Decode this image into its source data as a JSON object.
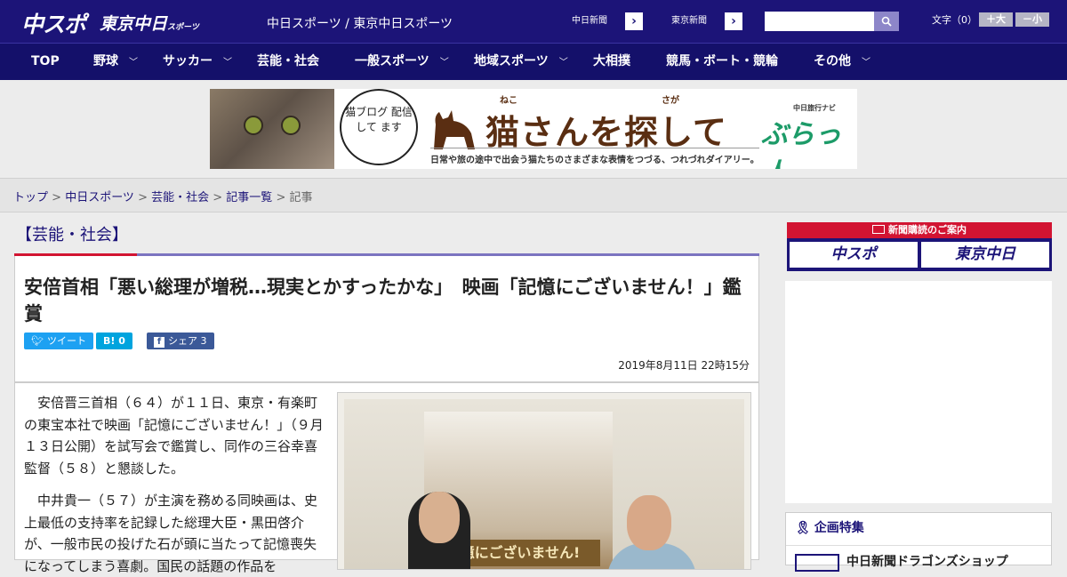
{
  "header": {
    "logo_main": "中スポ",
    "logo_tokyo": "東京中日",
    "logo_tokyo_small": "スポーツ",
    "site_name": "中日スポーツ / 東京中日スポーツ",
    "ext_links": [
      "中日新聞",
      "東京新聞"
    ],
    "search_placeholder": "",
    "font_label": "文字（0）",
    "font_larger": "＋大",
    "font_smaller": "－小"
  },
  "nav": {
    "items": [
      {
        "label": "TOP",
        "has_menu": false
      },
      {
        "label": "野球",
        "has_menu": true
      },
      {
        "label": "サッカー",
        "has_menu": true
      },
      {
        "label": "芸能・社会",
        "has_menu": false
      },
      {
        "label": "一般スポーツ",
        "has_menu": true
      },
      {
        "label": "地域スポーツ",
        "has_menu": true
      },
      {
        "label": "大相撲",
        "has_menu": false
      },
      {
        "label": "競馬・ボート・競輪",
        "has_menu": false
      },
      {
        "label": "その他",
        "has_menu": true
      }
    ]
  },
  "banner": {
    "bubble_text": "猫ブログ 配信して ます",
    "title": "猫さんを探して",
    "ruby_neko": "ねこ",
    "ruby_saga": "さが",
    "subtitle": "日常や旅の途中で出会う猫たちのさまざまな表情をつづる、つれづれダイアリー。",
    "navi_label": "中日旅行ナビ",
    "navi_brand": "ぶらっ人"
  },
  "breadcrumb": {
    "items": [
      "トップ",
      "中日スポーツ",
      "芸能・社会",
      "記事一覧"
    ],
    "current": "記事",
    "separator": " > "
  },
  "category": "【芸能・社会】",
  "article": {
    "headline": "安倍首相「悪い総理が増税…現実とかすったかな」　映画「記憶にございません！」鑑賞",
    "share": {
      "tweet": "ツイート",
      "hatena": "B! 0",
      "facebook": "シェア 3"
    },
    "date": "2019年8月11日 22時15分",
    "paragraphs": [
      "安倍晋三首相（６４）が１１日、東京・有楽町の東宝本社で映画「記憶にございません！」（９月１３日公開）を試写会で鑑賞し、同作の三谷幸喜監督（５８）と懇談した。",
      "中井貴一（５７）が主演を務める同映画は、史上最低の支持率を記録した総理大臣・黒田啓介が、一般市民の投げた石が頭に当たって記憶喪失になってしまう喜劇。国民の話題の作品を"
    ],
    "photo_poster_title": "憶にございません!"
  },
  "sidebar": {
    "subscribe_label": "新聞購読のご案内",
    "logos": [
      "中スポ",
      "東京中日"
    ],
    "feature_title": "企画特集",
    "feature_item": "中日新聞ドラゴンズショップ"
  },
  "colors": {
    "brand_navy": "#1c1478",
    "accent_red": "#d21432",
    "twitter": "#1da1f2",
    "hatena": "#00a4de",
    "facebook": "#3b5998"
  }
}
